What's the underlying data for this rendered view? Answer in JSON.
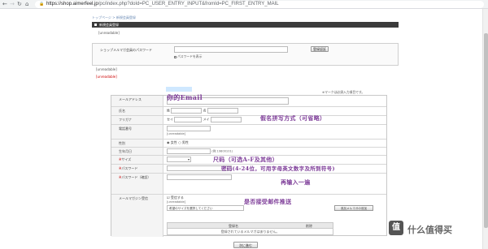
{
  "browser": {
    "url_host": "https://shop.aimerfeel.jp",
    "url_path": "/pc/index.php?doId=PC_USER_ENTRY_INPUT&fromId=PC_FIRST_ENTRY_MAIL"
  },
  "breadcrumb": "トップページ > 新規会員登録",
  "page_title": "新規会員登録",
  "intro": "[unreadable]",
  "login_box": {
    "label": "ショップメルマガ会員のパスワード",
    "password_note": "パスワードを表示",
    "button": "登録認証"
  },
  "notice_gray": "[unreadable]",
  "notice_red": "[unreadable]",
  "required_note": "※マークは必須入力項目です。",
  "form": {
    "rows": [
      {
        "label": "メールアドレス",
        "handwriting": "你的Email"
      },
      {
        "label": "氏名",
        "last_name_hint": "姓",
        "first_name_hint": "名"
      },
      {
        "label": "フリガナ",
        "last_kana_hint": "セイ",
        "first_kana_hint": "メイ",
        "handwriting": "假名拼写方式（可省略）"
      },
      {
        "label": "電話番号",
        "hint": "[unreadable]"
      },
      {
        "label": "性別",
        "option_a": "女性",
        "option_b": "男性"
      },
      {
        "label": "生年月日",
        "year_hint": "(例:19800101)"
      },
      {
        "label": "サイズ",
        "handwriting": "尺码（可选A-F及其他）"
      },
      {
        "label": "パスワード",
        "handwriting": "密码(4-24位，可用字母英文数字及所到符号)"
      },
      {
        "label": "パスワード（確認）",
        "handwriting": "再输入一遍"
      },
      {
        "label": "メールマガジン受信",
        "option": "受信する",
        "sub_note": "[unreadable]",
        "select_label": "希望のサイズを選択してください",
        "add_button": "追加メルマガの追加",
        "handwriting": "是否接受邮件推送"
      }
    ],
    "inner_table": {
      "header_left": "登録名",
      "header_right": "削除",
      "empty_text": "登録されているメルマガはありません。"
    }
  },
  "next_button": "次に進む",
  "watermark": {
    "icon_char": "值",
    "text": "什么值得买"
  },
  "colors": {
    "annotation": "#7d3c98",
    "title_bar": "#3b3b3b",
    "required_red": "#cc0000"
  }
}
